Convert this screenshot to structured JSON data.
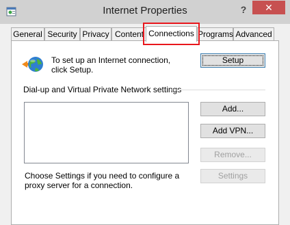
{
  "window": {
    "title": "Internet Properties",
    "help_label": "?",
    "close_label": "✕"
  },
  "tabs": [
    {
      "label": "General"
    },
    {
      "label": "Security"
    },
    {
      "label": "Privacy"
    },
    {
      "label": "Content"
    },
    {
      "label": "Connections",
      "selected": true
    },
    {
      "label": "Programs"
    },
    {
      "label": "Advanced"
    }
  ],
  "connections": {
    "setup_text": "To set up an Internet connection, click Setup.",
    "setup_button": "Setup",
    "vpn_group_label": "Dial-up and Virtual Private Network settings",
    "add_button": "Add...",
    "add_vpn_button": "Add VPN...",
    "remove_button": "Remove...",
    "settings_button": "Settings",
    "proxy_text": "Choose Settings if you need to configure a proxy server for a connection."
  },
  "icons": {
    "app": "internet-options-icon",
    "setup": "globe-connection-icon"
  },
  "colors": {
    "highlight": "#e8161c",
    "close_button": "#c75050"
  }
}
